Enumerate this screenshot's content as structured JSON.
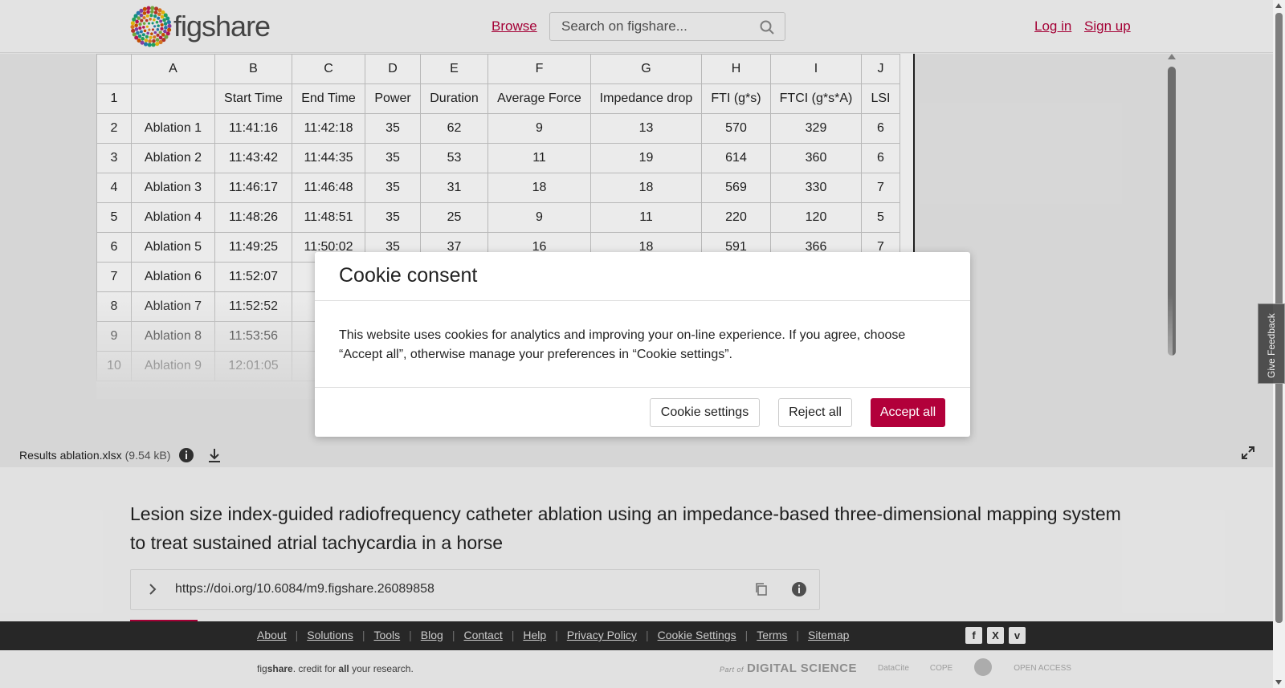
{
  "header": {
    "logo_text": "figshare",
    "browse": "Browse",
    "search_placeholder": "Search on figshare...",
    "login": "Log in",
    "signup": "Sign up"
  },
  "sheet": {
    "columns": [
      "",
      "A",
      "B",
      "C",
      "D",
      "E",
      "F",
      "G",
      "H",
      "I",
      "J"
    ],
    "rows": [
      [
        "1",
        "",
        "Start Time",
        "End Time",
        "Power",
        "Duration",
        "Average Force",
        "Impedance drop",
        "FTI (g*s)",
        "FTCI (g*s*A)",
        "LSI"
      ],
      [
        "2",
        "Ablation 1",
        "11:41:16",
        "11:42:18",
        "35",
        "62",
        "9",
        "13",
        "570",
        "329",
        "6"
      ],
      [
        "3",
        "Ablation 2",
        "11:43:42",
        "11:44:35",
        "35",
        "53",
        "11",
        "19",
        "614",
        "360",
        "6"
      ],
      [
        "4",
        "Ablation 3",
        "11:46:17",
        "11:46:48",
        "35",
        "31",
        "18",
        "18",
        "569",
        "330",
        "7"
      ],
      [
        "5",
        "Ablation 4",
        "11:48:26",
        "11:48:51",
        "35",
        "25",
        "9",
        "11",
        "220",
        "120",
        "5"
      ],
      [
        "6",
        "Ablation 5",
        "11:49:25",
        "11:50:02",
        "35",
        "37",
        "16",
        "18",
        "591",
        "366",
        "7"
      ],
      [
        "7",
        "Ablation 6",
        "11:52:07",
        "1",
        "",
        "",
        "",
        "",
        "",
        "",
        ""
      ],
      [
        "8",
        "Ablation 7",
        "11:52:52",
        "1",
        "",
        "",
        "",
        "",
        "",
        "",
        ""
      ],
      [
        "9",
        "Ablation 8",
        "11:53:56",
        "1",
        "",
        "",
        "",
        "",
        "",
        "",
        ""
      ],
      [
        "10",
        "Ablation 9",
        "12:01:05",
        "1",
        "",
        "",
        "",
        "",
        "",
        "",
        ""
      ]
    ]
  },
  "file": {
    "name": "Results ablation.xlsx",
    "size": "(9.54 kB)"
  },
  "cookie": {
    "title": "Cookie consent",
    "body": "This website uses cookies for analytics and improving your on-line experience. If you agree, choose “Accept all”, otherwise manage your preferences in “Cookie settings”.",
    "settings": "Cookie settings",
    "reject": "Reject all",
    "accept": "Accept all"
  },
  "article": {
    "title": "Lesion size index-guided radiofrequency catheter ablation using an impedance-based three-dimensional mapping system to treat sustained atrial tachycardia in a horse",
    "doi": "https://doi.org/10.6084/m9.figshare.26089858"
  },
  "footer": {
    "links": [
      "About",
      "Solutions",
      "Tools",
      "Blog",
      "Contact",
      "Help",
      "Privacy Policy",
      "Cookie Settings",
      "Terms",
      "Sitemap"
    ],
    "tagline_1": "fig",
    "tagline_2": "share",
    "tagline_3": ". credit for ",
    "tagline_4": "all",
    "tagline_5": " your research.",
    "partner_ds_prefix": "Part of",
    "partner_ds": "DIGITAL SCIENCE",
    "partner_datacite": "DataCite",
    "partner_cope": "COPE",
    "partner_oa": "OPEN ACCESS"
  },
  "feedback": "Give Feedback",
  "colors": {
    "brand": "#b2003a",
    "footer_bg": "#2b2b2b"
  }
}
